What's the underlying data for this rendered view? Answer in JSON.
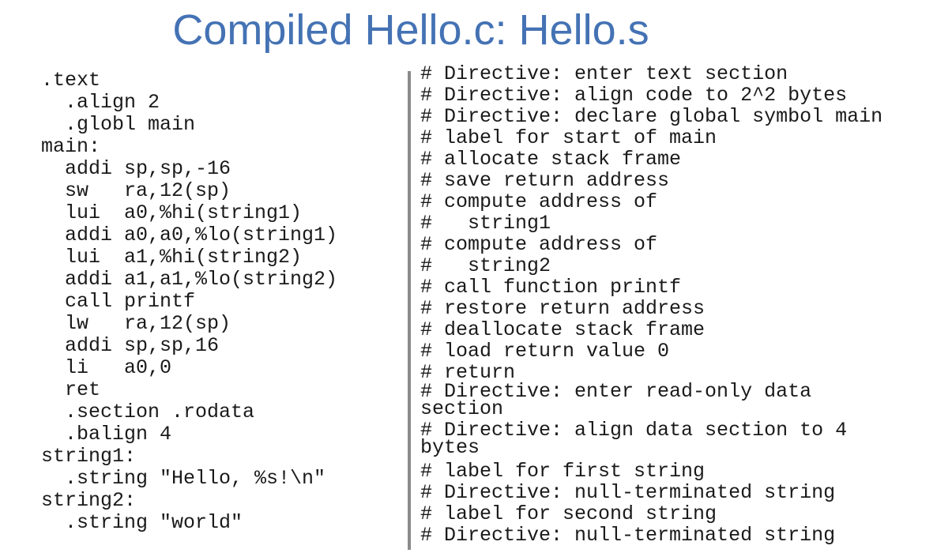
{
  "title": "Compiled Hello.c: Hello.s",
  "code_lines": [
    ".text",
    "  .align 2",
    "  .globl main",
    "main:",
    "  addi sp,sp,-16",
    "  sw   ra,12(sp)",
    "  lui  a0,%hi(string1)",
    "  addi a0,a0,%lo(string1)",
    "  lui  a1,%hi(string2)",
    "  addi a1,a1,%lo(string2)",
    "  call printf",
    "  lw   ra,12(sp)",
    "  addi sp,sp,16",
    "  li   a0,0",
    "  ret",
    "  .section .rodata",
    "  .balign 4",
    "string1:",
    "  .string \"Hello, %s!\\n\"",
    "string2:",
    "  .string \"world\""
  ],
  "comment_lines": [
    "# Directive: enter text section",
    "# Directive: align code to 2^2 bytes",
    "# Directive: declare global symbol main",
    "# label for start of main",
    "# allocate stack frame",
    "# save return address",
    "# compute address of",
    "#   string1",
    "# compute address of",
    "#   string2",
    "# call function printf",
    "# restore return address",
    "# deallocate stack frame",
    "# load return value 0",
    "# return",
    "# Directive: enter read-only data\nsection",
    "# Directive: align data section to 4\nbytes",
    "# label for first string",
    "# Directive: null-terminated string",
    "# label for second string",
    "# Directive: null-terminated string"
  ]
}
